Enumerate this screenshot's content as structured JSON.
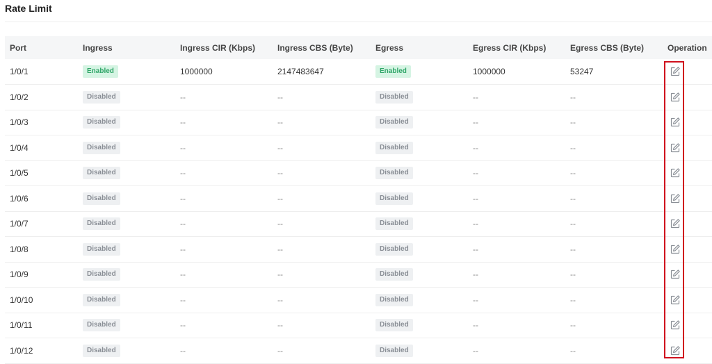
{
  "page": {
    "title": "Rate Limit"
  },
  "table": {
    "headers": [
      "Port",
      "Ingress",
      "Ingress CIR (Kbps)",
      "Ingress CBS (Byte)",
      "Egress",
      "Egress CIR (Kbps)",
      "Egress CBS (Byte)",
      "Operation"
    ],
    "rows": [
      {
        "port": "1/0/1",
        "ingress": "Enabled",
        "ingress_cir": "1000000",
        "ingress_cbs": "2147483647",
        "egress": "Enabled",
        "egress_cir": "1000000",
        "egress_cbs": "53247"
      },
      {
        "port": "1/0/2",
        "ingress": "Disabled",
        "ingress_cir": "--",
        "ingress_cbs": "--",
        "egress": "Disabled",
        "egress_cir": "--",
        "egress_cbs": "--"
      },
      {
        "port": "1/0/3",
        "ingress": "Disabled",
        "ingress_cir": "--",
        "ingress_cbs": "--",
        "egress": "Disabled",
        "egress_cir": "--",
        "egress_cbs": "--"
      },
      {
        "port": "1/0/4",
        "ingress": "Disabled",
        "ingress_cir": "--",
        "ingress_cbs": "--",
        "egress": "Disabled",
        "egress_cir": "--",
        "egress_cbs": "--"
      },
      {
        "port": "1/0/5",
        "ingress": "Disabled",
        "ingress_cir": "--",
        "ingress_cbs": "--",
        "egress": "Disabled",
        "egress_cir": "--",
        "egress_cbs": "--"
      },
      {
        "port": "1/0/6",
        "ingress": "Disabled",
        "ingress_cir": "--",
        "ingress_cbs": "--",
        "egress": "Disabled",
        "egress_cir": "--",
        "egress_cbs": "--"
      },
      {
        "port": "1/0/7",
        "ingress": "Disabled",
        "ingress_cir": "--",
        "ingress_cbs": "--",
        "egress": "Disabled",
        "egress_cir": "--",
        "egress_cbs": "--"
      },
      {
        "port": "1/0/8",
        "ingress": "Disabled",
        "ingress_cir": "--",
        "ingress_cbs": "--",
        "egress": "Disabled",
        "egress_cir": "--",
        "egress_cbs": "--"
      },
      {
        "port": "1/0/9",
        "ingress": "Disabled",
        "ingress_cir": "--",
        "ingress_cbs": "--",
        "egress": "Disabled",
        "egress_cir": "--",
        "egress_cbs": "--"
      },
      {
        "port": "1/0/10",
        "ingress": "Disabled",
        "ingress_cir": "--",
        "ingress_cbs": "--",
        "egress": "Disabled",
        "egress_cir": "--",
        "egress_cbs": "--"
      },
      {
        "port": "1/0/11",
        "ingress": "Disabled",
        "ingress_cir": "--",
        "ingress_cbs": "--",
        "egress": "Disabled",
        "egress_cir": "--",
        "egress_cbs": "--"
      },
      {
        "port": "1/0/12",
        "ingress": "Disabled",
        "ingress_cir": "--",
        "ingress_cbs": "--",
        "egress": "Disabled",
        "egress_cir": "--",
        "egress_cbs": "--"
      }
    ]
  },
  "icons": {
    "operation": "edit-icon"
  },
  "colors": {
    "enabled_text": "#2ea567",
    "enabled_bg": "#d5f4e3",
    "disabled_text": "#8a8f96",
    "disabled_bg": "#eef0f2",
    "highlight": "#d0101d"
  }
}
